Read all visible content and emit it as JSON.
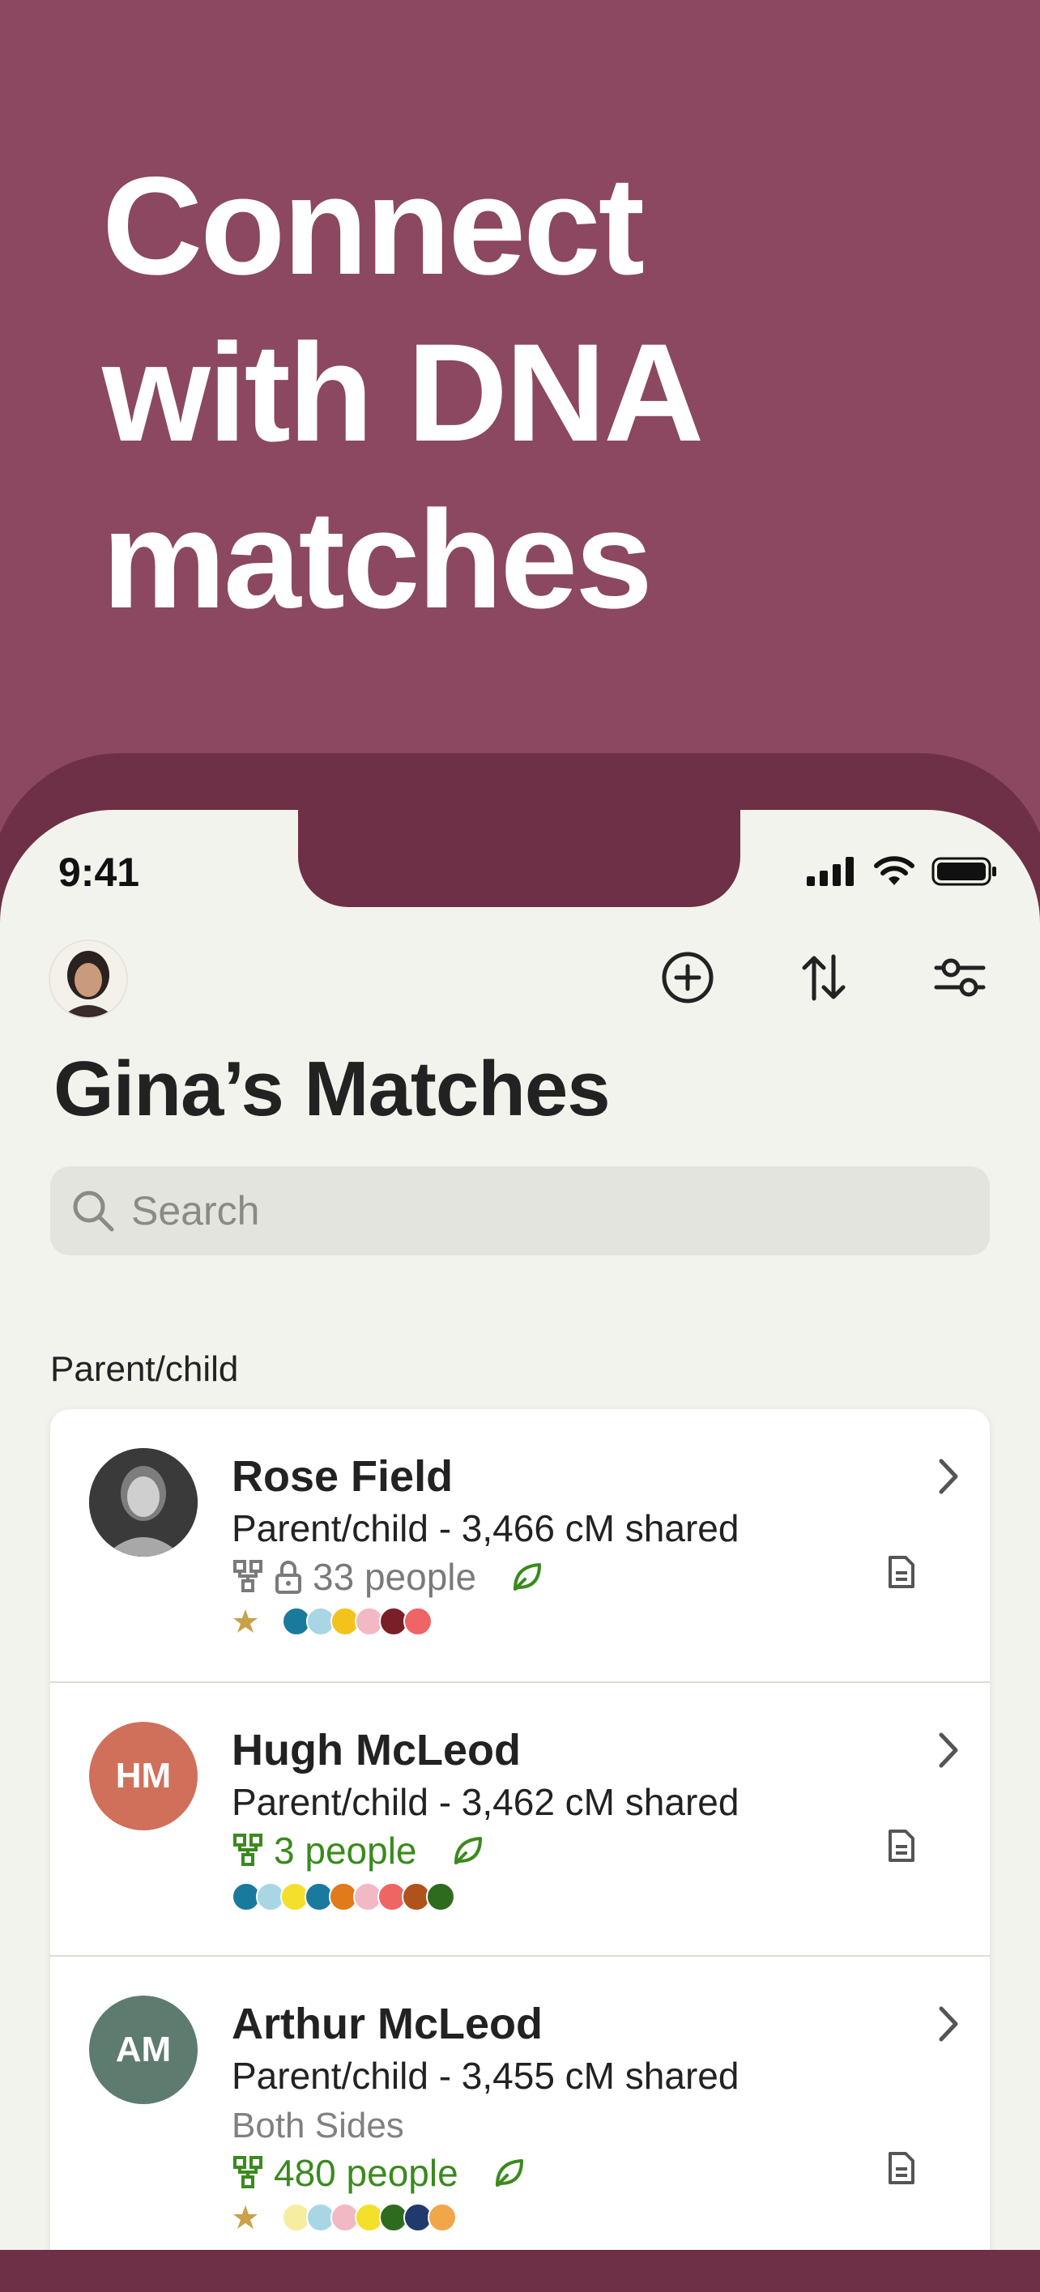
{
  "headline": [
    "Connect",
    "with DNA",
    "matches"
  ],
  "status_bar": {
    "time": "9:41"
  },
  "header": {
    "title": "Gina’s Matches"
  },
  "search": {
    "placeholder": "Search"
  },
  "section": {
    "label": "Parent/child"
  },
  "matches": [
    {
      "name": "Rose Field",
      "relationship": "Parent/child - 3,466 cM shared",
      "side": "",
      "people": "33 people",
      "tree_locked": true,
      "starred": true,
      "initials": "",
      "avatar_color": "#333333",
      "people_color": "#7a7a7a",
      "dot_colors": [
        "#1a7a9e",
        "#a9d6e5",
        "#f2c31b",
        "#f2b8c4",
        "#7a1f27",
        "#ef6464"
      ]
    },
    {
      "name": "Hugh McLeod",
      "relationship": "Parent/child - 3,462 cM shared",
      "side": "",
      "people": "3 people",
      "tree_locked": false,
      "starred": false,
      "initials": "HM",
      "avatar_color": "#d0705a",
      "people_color": "#3a8a1e",
      "dot_colors": [
        "#1a7a9e",
        "#a9d6e5",
        "#f4e02a",
        "#1a7a9e",
        "#e07a1a",
        "#f2b8c4",
        "#ef6464",
        "#b0521c",
        "#2f6b1f"
      ]
    },
    {
      "name": "Arthur McLeod",
      "relationship": "Parent/child - 3,455 cM shared",
      "side": "Both Sides",
      "people": "480 people",
      "tree_locked": false,
      "starred": true,
      "initials": "AM",
      "avatar_color": "#5e7b6f",
      "people_color": "#3a8a1e",
      "dot_colors": [
        "#f7eda0",
        "#a9d6e5",
        "#f2b8c4",
        "#f4e02a",
        "#2f6b1f",
        "#1f3a6b",
        "#f2a64a"
      ]
    }
  ],
  "colors": {
    "hero_bg": "#8b4860",
    "frame": "#6e3046",
    "screen_bg": "#f3f3ed",
    "accent_green": "#3a8a1e",
    "star": "#c9a14a"
  },
  "icons": [
    "plus-circle-icon",
    "sort-icon",
    "filter-icon",
    "search-icon",
    "tree-icon",
    "lock-icon",
    "leaf-icon",
    "document-icon",
    "chevron-right-icon",
    "star-icon"
  ]
}
